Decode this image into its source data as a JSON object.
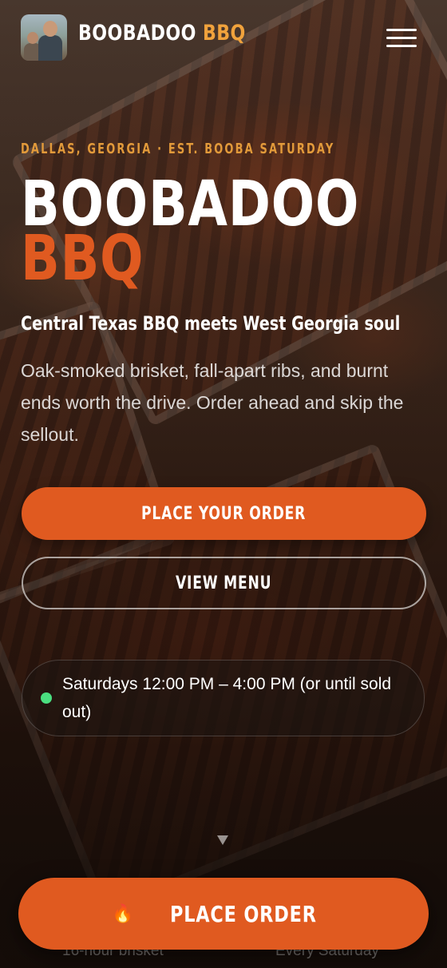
{
  "header": {
    "brand_name": "BOOBADOO",
    "brand_accent": "BBQ",
    "menu_icon": "hamburger-menu-icon"
  },
  "hero": {
    "eyebrow": "DALLAS, GEORGIA · EST. BOOBA SATURDAY",
    "headline_line1": "BOOBADOO",
    "headline_line2": "BBQ",
    "tagline": "Central Texas BBQ meets West Georgia soul",
    "description": "Oak-smoked brisket, fall-apart ribs, and burnt ends worth the drive. Order ahead and skip the sellout."
  },
  "actions": {
    "primary_label": "PLACE YOUR ORDER",
    "secondary_label": "VIEW MENU"
  },
  "hours": {
    "status_icon": "status-dot-icon",
    "text": "Saturdays 12:00 PM – 4:00 PM (or until sold out)"
  },
  "scroll_icon": "scroll-down-arrow-icon",
  "stats": {
    "left": "16-hour brisket",
    "right": "Every Saturday"
  },
  "sticky_cta": {
    "icon": "fire-icon",
    "emoji": "🔥",
    "label": "PLACE ORDER"
  },
  "colors": {
    "accent_orange": "#e05a20",
    "accent_gold": "#f0a23c",
    "status_green": "#4ade80"
  }
}
